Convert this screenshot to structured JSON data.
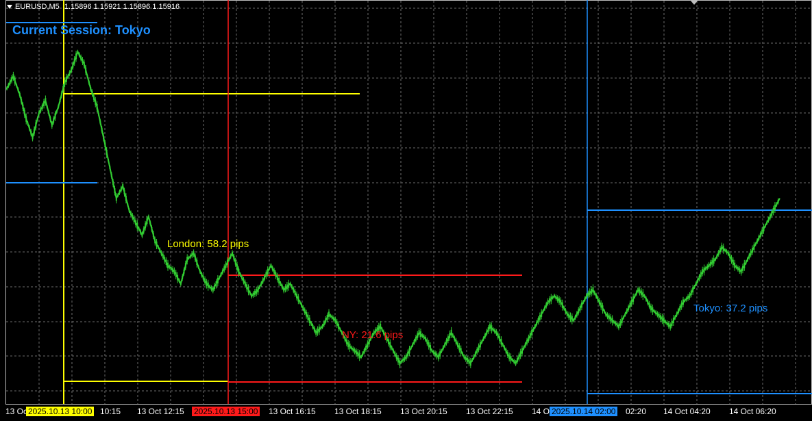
{
  "header": {
    "symbol": "EURUSD,M5",
    "ohlc": "1.15896 1.15921 1.15896 1.15916"
  },
  "current_session": "Current Session: Tokyo",
  "sessions": [
    {
      "name": "London",
      "label": "London: 58.2 pips",
      "color": "#ffff00",
      "start_tag": "2025.10.13 10:00",
      "tag_bg": "#ffff00",
      "tag_fg": "#000000"
    },
    {
      "name": "NY",
      "label": "NY: 21.6 pips",
      "color": "#ff1a1a",
      "start_tag": "2025.10.13 15:00",
      "tag_bg": "#ff1a1a",
      "tag_fg": "#000000"
    },
    {
      "name": "Tokyo",
      "label": "Tokyo: 37.2 pips",
      "color": "#1e90ff",
      "start_tag": "2025.10.14 02:00",
      "tag_bg": "#1e90ff",
      "tag_fg": "#000000"
    }
  ],
  "x_axis": {
    "labels": [
      "13 Oc",
      "10:15",
      "13 Oct 12:15",
      "13 Oct 16:15",
      "13 Oct 18:15",
      "13 Oct 20:15",
      "13 Oct 22:15",
      "14 O",
      "02:20",
      "14 Oct 04:20",
      "14 Oct 06:20"
    ]
  },
  "colors": {
    "background": "#000000",
    "grid": "#6b6b6b",
    "candle": "#32cd32",
    "text": "#ffffff"
  },
  "chart_data": {
    "type": "line",
    "series": [
      {
        "values": [
          60,
          62,
          59,
          55,
          52,
          56,
          58,
          54,
          57,
          61,
          63,
          66,
          64,
          60,
          57,
          52,
          47,
          42,
          44,
          40,
          38,
          36,
          39,
          35,
          33,
          31,
          30,
          28,
          32,
          33,
          30,
          28,
          27,
          29,
          31,
          33,
          30,
          28,
          26,
          27,
          29,
          31,
          29,
          27,
          28,
          26,
          24,
          22,
          20,
          21,
          23,
          22,
          20,
          18,
          17,
          16,
          18,
          20,
          21,
          19,
          17,
          15,
          16,
          18,
          20,
          19,
          17,
          16,
          18,
          20,
          18,
          16,
          15,
          17,
          19,
          21,
          20,
          18,
          16,
          15,
          17,
          19,
          21,
          23,
          25,
          26,
          25,
          23,
          22,
          24,
          26,
          27,
          25,
          23,
          22,
          21,
          23,
          25,
          27,
          26,
          24,
          23,
          22,
          21,
          23,
          25,
          26,
          28,
          30,
          31,
          32,
          34,
          33,
          31,
          30,
          32,
          34,
          36,
          38,
          40,
          42
        ]
      }
    ]
  }
}
